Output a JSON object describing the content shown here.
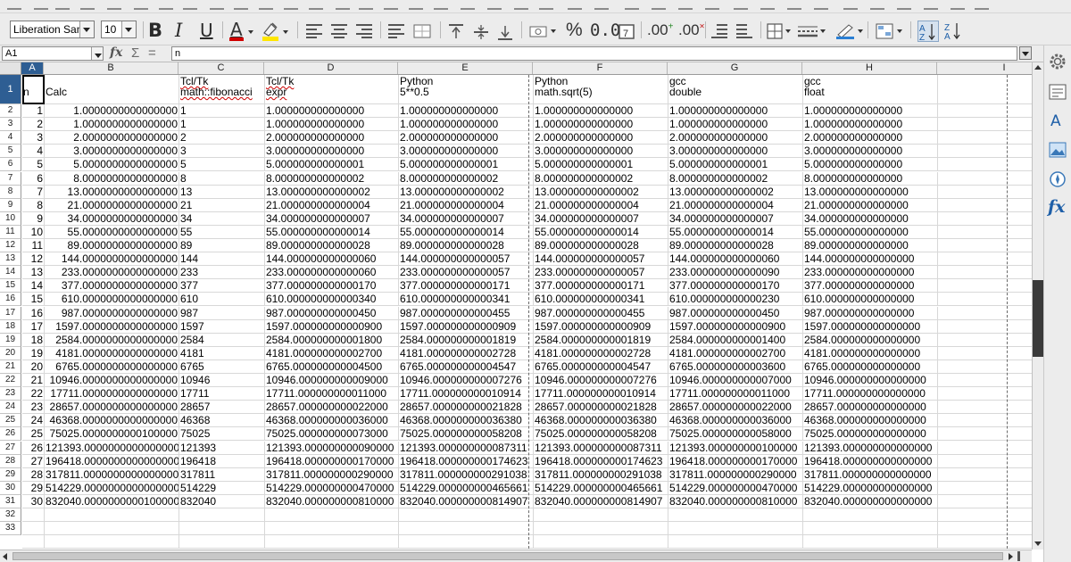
{
  "toolbar": {
    "font_name": "Liberation Sans",
    "font_size": "10",
    "bold_label": "B",
    "italic_label": "I",
    "underline_label": "U",
    "font_color_label": "A",
    "percent_label": "%",
    "number_format_label": "0.0",
    "add_decimal_label": ".00",
    "delete_decimal_label": ".00",
    "font_color_value": "#d00000",
    "highlight_color_value": "#ffe600"
  },
  "formula_bar": {
    "cell_reference": "A1",
    "fx_label": "fx",
    "sum_label": "Σ",
    "equals_label": "=",
    "content": "n"
  },
  "sheet": {
    "columns": [
      "A",
      "B",
      "C",
      "D",
      "E",
      "F",
      "G",
      "H",
      "I"
    ],
    "selected_column": "A",
    "header": [
      [
        "",
        "n"
      ],
      [
        "",
        "Calc"
      ],
      [
        "Tcl/Tk",
        "math::fibonacci"
      ],
      [
        "Tcl/Tk",
        "expr"
      ],
      [
        "Python",
        "5**0.5"
      ],
      [
        "Python",
        "math.sqrt(5)"
      ],
      [
        "gcc",
        "double"
      ],
      [
        "gcc",
        "float"
      ],
      [
        "",
        ""
      ]
    ],
    "rows": [
      [
        "1",
        "1.0000000000000000",
        "1",
        "1.000000000000000",
        "1.000000000000000",
        "1.000000000000000",
        "1.000000000000000",
        "1.000000000000000"
      ],
      [
        "2",
        "1.0000000000000000",
        "1",
        "1.000000000000000",
        "1.000000000000000",
        "1.000000000000000",
        "1.000000000000000",
        "1.000000000000000"
      ],
      [
        "3",
        "2.0000000000000000",
        "2",
        "2.000000000000000",
        "2.000000000000000",
        "2.000000000000000",
        "2.000000000000000",
        "2.000000000000000"
      ],
      [
        "4",
        "3.0000000000000000",
        "3",
        "3.000000000000000",
        "3.000000000000000",
        "3.000000000000000",
        "3.000000000000000",
        "3.000000000000000"
      ],
      [
        "5",
        "5.0000000000000000",
        "5",
        "5.000000000000001",
        "5.000000000000001",
        "5.000000000000001",
        "5.000000000000001",
        "5.000000000000000"
      ],
      [
        "6",
        "8.0000000000000000",
        "8",
        "8.000000000000002",
        "8.000000000000002",
        "8.000000000000002",
        "8.000000000000002",
        "8.000000000000000"
      ],
      [
        "7",
        "13.0000000000000000",
        "13",
        "13.000000000000002",
        "13.000000000000002",
        "13.000000000000002",
        "13.000000000000002",
        "13.000000000000000"
      ],
      [
        "8",
        "21.0000000000000000",
        "21",
        "21.000000000000004",
        "21.000000000000004",
        "21.000000000000004",
        "21.000000000000004",
        "21.000000000000000"
      ],
      [
        "9",
        "34.0000000000000000",
        "34",
        "34.000000000000007",
        "34.000000000000007",
        "34.000000000000007",
        "34.000000000000007",
        "34.000000000000000"
      ],
      [
        "10",
        "55.0000000000000000",
        "55",
        "55.000000000000014",
        "55.000000000000014",
        "55.000000000000014",
        "55.000000000000014",
        "55.000000000000000"
      ],
      [
        "11",
        "89.0000000000000000",
        "89",
        "89.000000000000028",
        "89.000000000000028",
        "89.000000000000028",
        "89.000000000000028",
        "89.000000000000000"
      ],
      [
        "12",
        "144.0000000000000000",
        "144",
        "144.000000000000060",
        "144.000000000000057",
        "144.000000000000057",
        "144.000000000000060",
        "144.000000000000000"
      ],
      [
        "13",
        "233.0000000000000000",
        "233",
        "233.000000000000060",
        "233.000000000000057",
        "233.000000000000057",
        "233.000000000000090",
        "233.000000000000000"
      ],
      [
        "14",
        "377.0000000000000000",
        "377",
        "377.000000000000170",
        "377.000000000000171",
        "377.000000000000171",
        "377.000000000000170",
        "377.000000000000000"
      ],
      [
        "15",
        "610.0000000000000000",
        "610",
        "610.000000000000340",
        "610.000000000000341",
        "610.000000000000341",
        "610.000000000000230",
        "610.000000000000000"
      ],
      [
        "16",
        "987.0000000000000000",
        "987",
        "987.000000000000450",
        "987.000000000000455",
        "987.000000000000455",
        "987.000000000000450",
        "987.000000000000000"
      ],
      [
        "17",
        "1597.0000000000000000",
        "1597",
        "1597.000000000000900",
        "1597.000000000000909",
        "1597.000000000000909",
        "1597.000000000000900",
        "1597.000000000000000"
      ],
      [
        "18",
        "2584.0000000000000000",
        "2584",
        "2584.000000000001800",
        "2584.000000000001819",
        "2584.000000000001819",
        "2584.000000000001400",
        "2584.000000000000000"
      ],
      [
        "19",
        "4181.0000000000000000",
        "4181",
        "4181.000000000002700",
        "4181.000000000002728",
        "4181.000000000002728",
        "4181.000000000002700",
        "4181.000000000000000"
      ],
      [
        "20",
        "6765.0000000000000000",
        "6765",
        "6765.000000000004500",
        "6765.000000000004547",
        "6765.000000000004547",
        "6765.000000000003600",
        "6765.000000000000000"
      ],
      [
        "21",
        "10946.0000000000000000",
        "10946",
        "10946.000000000009000",
        "10946.000000000007276",
        "10946.000000000007276",
        "10946.000000000007000",
        "10946.000000000000000"
      ],
      [
        "22",
        "17711.0000000000000000",
        "17711",
        "17711.000000000011000",
        "17711.000000000010914",
        "17711.000000000010914",
        "17711.000000000011000",
        "17711.000000000000000"
      ],
      [
        "23",
        "28657.0000000000000000",
        "28657",
        "28657.000000000022000",
        "28657.000000000021828",
        "28657.000000000021828",
        "28657.000000000022000",
        "28657.000000000000000"
      ],
      [
        "24",
        "46368.0000000000000000",
        "46368",
        "46368.000000000036000",
        "46368.000000000036380",
        "46368.000000000036380",
        "46368.000000000036000",
        "46368.000000000000000"
      ],
      [
        "25",
        "75025.0000000000100000",
        "75025",
        "75025.000000000073000",
        "75025.000000000058208",
        "75025.000000000058208",
        "75025.000000000058000",
        "75025.000000000000000"
      ],
      [
        "26",
        "121393.0000000000000000",
        "121393",
        "121393.000000000090000",
        "121393.000000000087311",
        "121393.000000000087311",
        "121393.000000000100000",
        "121393.000000000000000"
      ],
      [
        "27",
        "196418.0000000000000000",
        "196418",
        "196418.000000000170000",
        "196418.000000000174623",
        "196418.000000000174623",
        "196418.000000000170000",
        "196418.000000000000000"
      ],
      [
        "28",
        "317811.0000000000000000",
        "317811",
        "317811.000000000290000",
        "317811.000000000291038",
        "317811.000000000291038",
        "317811.000000000290000",
        "317811.000000000000000"
      ],
      [
        "29",
        "514229.0000000000000000",
        "514229",
        "514229.000000000470000",
        "514229.000000000465661",
        "514229.000000000465661",
        "514229.000000000470000",
        "514229.000000000000000"
      ],
      [
        "30",
        "832040.0000000000100000",
        "832040",
        "832040.000000000810000",
        "832040.000000000814907",
        "832040.000000000814907",
        "832040.000000000810000",
        "832040.000000000000000"
      ]
    ],
    "row_numbers": [
      "1",
      "2",
      "3",
      "4",
      "5",
      "6",
      "7",
      "8",
      "9",
      "10",
      "11",
      "12",
      "13",
      "14",
      "15",
      "16",
      "17",
      "18",
      "19",
      "20",
      "21",
      "22",
      "23",
      "24",
      "25",
      "26",
      "27",
      "28",
      "29",
      "30",
      "31",
      "32",
      "33"
    ],
    "selected_row": "1"
  },
  "sidebar": {
    "items": [
      "gear-icon",
      "properties-icon",
      "styles-icon",
      "gallery-icon",
      "navigator-icon",
      "functions-icon"
    ],
    "functions_label": "fx"
  },
  "colors": {
    "selection": "#2e5e93",
    "chrome": "#ececec",
    "gridline": "#d8d8d8"
  }
}
